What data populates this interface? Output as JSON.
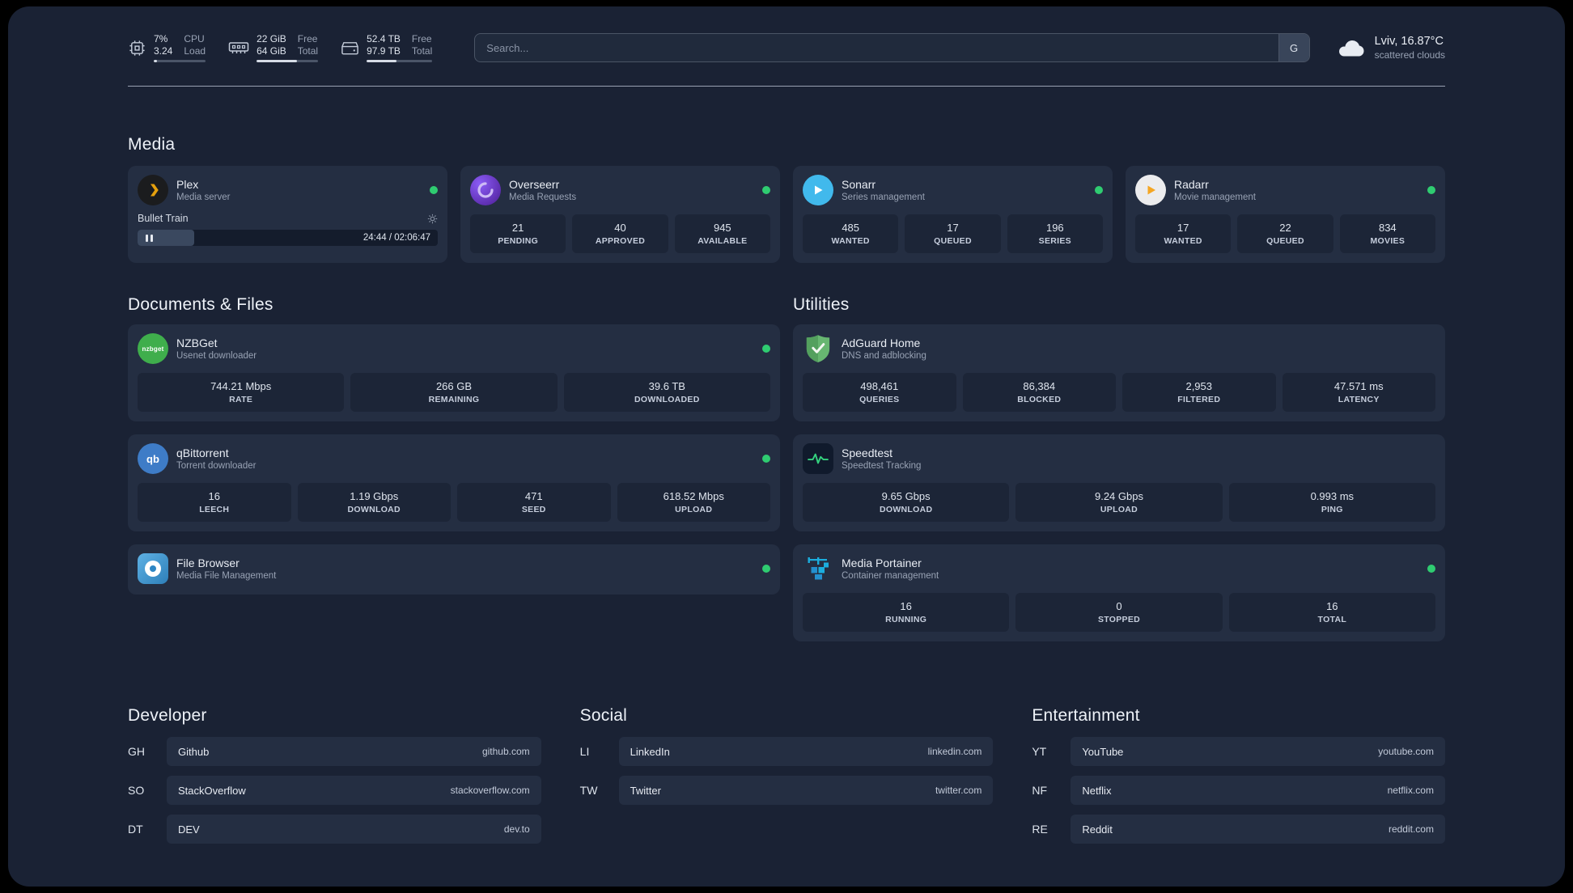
{
  "topbar": {
    "cpu": {
      "value1": "7%",
      "value2": "3.24",
      "label1": "CPU",
      "label2": "Load",
      "bar_pct": 7
    },
    "memory": {
      "value1": "22 GiB",
      "value2": "64 GiB",
      "label1": "Free",
      "label2": "Total",
      "bar_pct": 66
    },
    "disk": {
      "value1": "52.4 TB",
      "value2": "97.9 TB",
      "label1": "Free",
      "label2": "Total",
      "bar_pct": 46
    },
    "search": {
      "placeholder": "Search...",
      "button_label": "G"
    },
    "weather": {
      "location": "Lviv, 16.87°C",
      "condition": "scattered clouds"
    }
  },
  "sections": {
    "media": "Media",
    "documents": "Documents & Files",
    "utilities": "Utilities",
    "developer": "Developer",
    "social": "Social",
    "entertainment": "Entertainment"
  },
  "services": {
    "plex": {
      "name": "Plex",
      "desc": "Media server",
      "online": true,
      "player": {
        "title": "Bullet Train",
        "time": "24:44 / 02:06:47",
        "progress_pct": 19
      }
    },
    "overseerr": {
      "name": "Overseerr",
      "desc": "Media Requests",
      "online": true,
      "stats": [
        {
          "value": "21",
          "label": "PENDING"
        },
        {
          "value": "40",
          "label": "APPROVED"
        },
        {
          "value": "945",
          "label": "AVAILABLE"
        }
      ]
    },
    "sonarr": {
      "name": "Sonarr",
      "desc": "Series management",
      "online": true,
      "stats": [
        {
          "value": "485",
          "label": "WANTED"
        },
        {
          "value": "17",
          "label": "QUEUED"
        },
        {
          "value": "196",
          "label": "SERIES"
        }
      ]
    },
    "radarr": {
      "name": "Radarr",
      "desc": "Movie management",
      "online": true,
      "stats": [
        {
          "value": "17",
          "label": "WANTED"
        },
        {
          "value": "22",
          "label": "QUEUED"
        },
        {
          "value": "834",
          "label": "MOVIES"
        }
      ]
    },
    "nzbget": {
      "name": "NZBGet",
      "desc": "Usenet downloader",
      "online": true,
      "stats": [
        {
          "value": "744.21 Mbps",
          "label": "RATE"
        },
        {
          "value": "266 GB",
          "label": "REMAINING"
        },
        {
          "value": "39.6 TB",
          "label": "DOWNLOADED"
        }
      ]
    },
    "qbittorrent": {
      "name": "qBittorrent",
      "desc": "Torrent downloader",
      "online": true,
      "stats": [
        {
          "value": "16",
          "label": "LEECH"
        },
        {
          "value": "1.19 Gbps",
          "label": "DOWNLOAD"
        },
        {
          "value": "471",
          "label": "SEED"
        },
        {
          "value": "618.52 Mbps",
          "label": "UPLOAD"
        }
      ]
    },
    "filebrowser": {
      "name": "File Browser",
      "desc": "Media File Management",
      "online": true
    },
    "adguard": {
      "name": "AdGuard Home",
      "desc": "DNS and adblocking",
      "stats": [
        {
          "value": "498,461",
          "label": "QUERIES"
        },
        {
          "value": "86,384",
          "label": "BLOCKED"
        },
        {
          "value": "2,953",
          "label": "FILTERED"
        },
        {
          "value": "47.571 ms",
          "label": "LATENCY"
        }
      ]
    },
    "speedtest": {
      "name": "Speedtest",
      "desc": "Speedtest Tracking",
      "stats": [
        {
          "value": "9.65 Gbps",
          "label": "DOWNLOAD"
        },
        {
          "value": "9.24 Gbps",
          "label": "UPLOAD"
        },
        {
          "value": "0.993 ms",
          "label": "PING"
        }
      ]
    },
    "portainer": {
      "name": "Media Portainer",
      "desc": "Container management",
      "online": true,
      "stats": [
        {
          "value": "16",
          "label": "RUNNING"
        },
        {
          "value": "0",
          "label": "STOPPED"
        },
        {
          "value": "16",
          "label": "TOTAL"
        }
      ]
    }
  },
  "bookmarks": {
    "developer": [
      {
        "abbr": "GH",
        "name": "Github",
        "url": "github.com"
      },
      {
        "abbr": "SO",
        "name": "StackOverflow",
        "url": "stackoverflow.com"
      },
      {
        "abbr": "DT",
        "name": "DEV",
        "url": "dev.to"
      }
    ],
    "social": [
      {
        "abbr": "LI",
        "name": "LinkedIn",
        "url": "linkedin.com"
      },
      {
        "abbr": "TW",
        "name": "Twitter",
        "url": "twitter.com"
      }
    ],
    "entertainment": [
      {
        "abbr": "YT",
        "name": "YouTube",
        "url": "youtube.com"
      },
      {
        "abbr": "NF",
        "name": "Netflix",
        "url": "netflix.com"
      },
      {
        "abbr": "RE",
        "name": "Reddit",
        "url": "reddit.com"
      }
    ]
  },
  "colors": {
    "background": "#1a2234",
    "card": "#242e42",
    "stat_tile": "#1c2537",
    "status_online": "#2fcc71",
    "plex_accent": "#e5a00d",
    "speedtest_accent": "#34d17e",
    "portainer_accent": "#1badde"
  }
}
